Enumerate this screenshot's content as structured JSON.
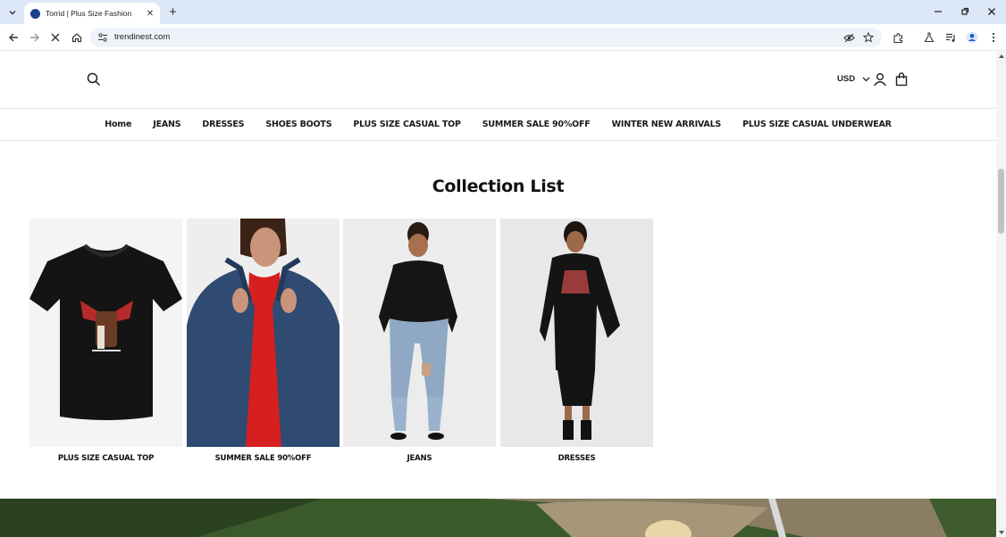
{
  "browser": {
    "tab_title": "Torrid | Plus Size Fashion",
    "url": "trendinest.com"
  },
  "header": {
    "currency": "USD"
  },
  "nav": {
    "items": [
      "Home",
      "JEANS",
      "DRESSES",
      "SHOES BOOTS",
      "PLUS SIZE CASUAL TOP",
      "SUMMER SALE 90%OFF",
      "WINTER NEW ARRIVALS",
      "PLUS SIZE CASUAL UNDERWEAR"
    ]
  },
  "collection": {
    "title": "Collection List",
    "cards": [
      {
        "label": "PLUS SIZE CASUAL TOP"
      },
      {
        "label": "SUMMER SALE 90%OFF"
      },
      {
        "label": "JEANS"
      },
      {
        "label": "DRESSES"
      }
    ]
  }
}
